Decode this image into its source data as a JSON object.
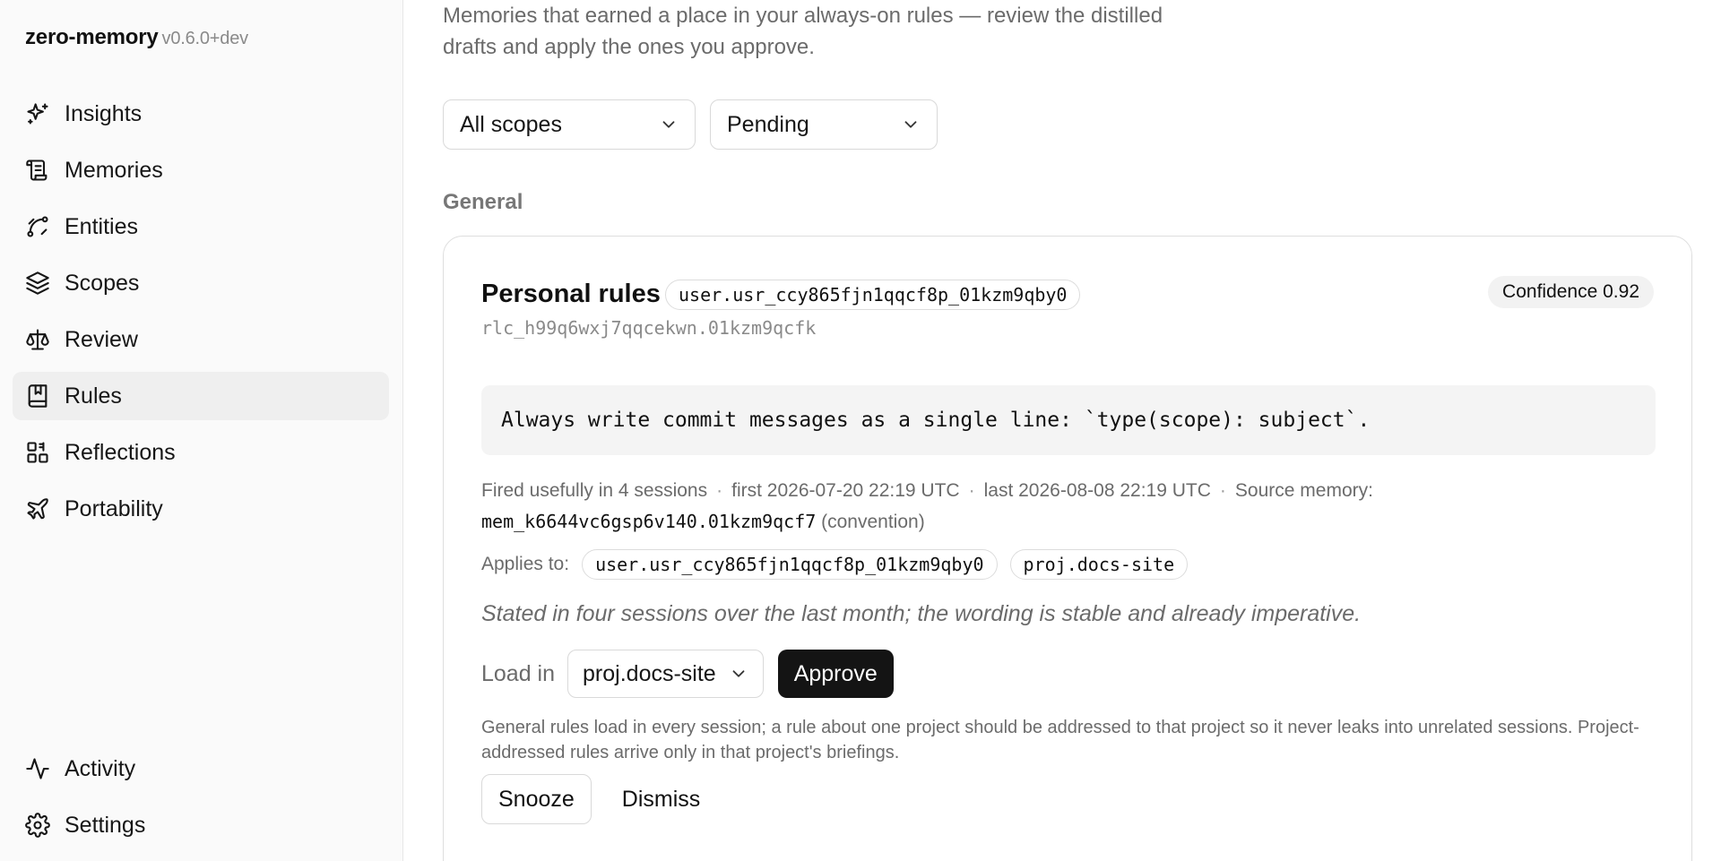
{
  "sidebar": {
    "brand": "zero-memory",
    "version": "v0.6.0+dev",
    "items": [
      {
        "label": "Insights",
        "icon": "sparkles-icon"
      },
      {
        "label": "Memories",
        "icon": "scroll-icon"
      },
      {
        "label": "Entities",
        "icon": "spline-icon"
      },
      {
        "label": "Scopes",
        "icon": "layers-icon"
      },
      {
        "label": "Review",
        "icon": "scale-icon"
      },
      {
        "label": "Rules",
        "icon": "book-marked-icon",
        "active": true
      },
      {
        "label": "Reflections",
        "icon": "blocks-icon"
      },
      {
        "label": "Portability",
        "icon": "plane-icon"
      }
    ],
    "bottom_items": [
      {
        "label": "Activity",
        "icon": "activity-icon"
      },
      {
        "label": "Settings",
        "icon": "gear-icon"
      }
    ]
  },
  "main": {
    "intro": "Memories that earned a place in your always-on rules — review the distilled drafts and apply the ones you approve.",
    "filters": {
      "scope": "All scopes",
      "status": "Pending"
    },
    "section_title": "General",
    "card": {
      "title": "Personal rules",
      "title_scope": "user.usr_ccy865fjn1qqcf8p_01kzm9qby0",
      "rule_id": "rlc_h99q6wxj7qqcekwn.01kzm9qcfk",
      "confidence": "Confidence 0.92",
      "rule_text": "Always write commit messages as a single line: `type(scope): subject`.",
      "meta": {
        "fired": "Fired usefully in 4 sessions",
        "first": "first 2026-07-20 22:19 UTC",
        "last": "last 2026-08-08 22:19 UTC",
        "source_label": "Source memory:",
        "source_memory": "mem_k6644vc6gsp6v140.01kzm9qcf7",
        "source_kind": "(convention)",
        "separator": "·"
      },
      "applies_label": "Applies to:",
      "applies_to": [
        "user.usr_ccy865fjn1qqcf8p_01kzm9qby0",
        "proj.docs-site"
      ],
      "note": "Stated in four sessions over the last month; the wording is stable and already imperative.",
      "load_label": "Load in",
      "load_value": "proj.docs-site",
      "approve_label": "Approve",
      "help": "General rules load in every session; a rule about one project should be addressed to that project so it never leaks into unrelated sessions. Project-addressed rules arrive only in that project's briefings.",
      "snooze_label": "Snooze",
      "dismiss_label": "Dismiss"
    }
  }
}
